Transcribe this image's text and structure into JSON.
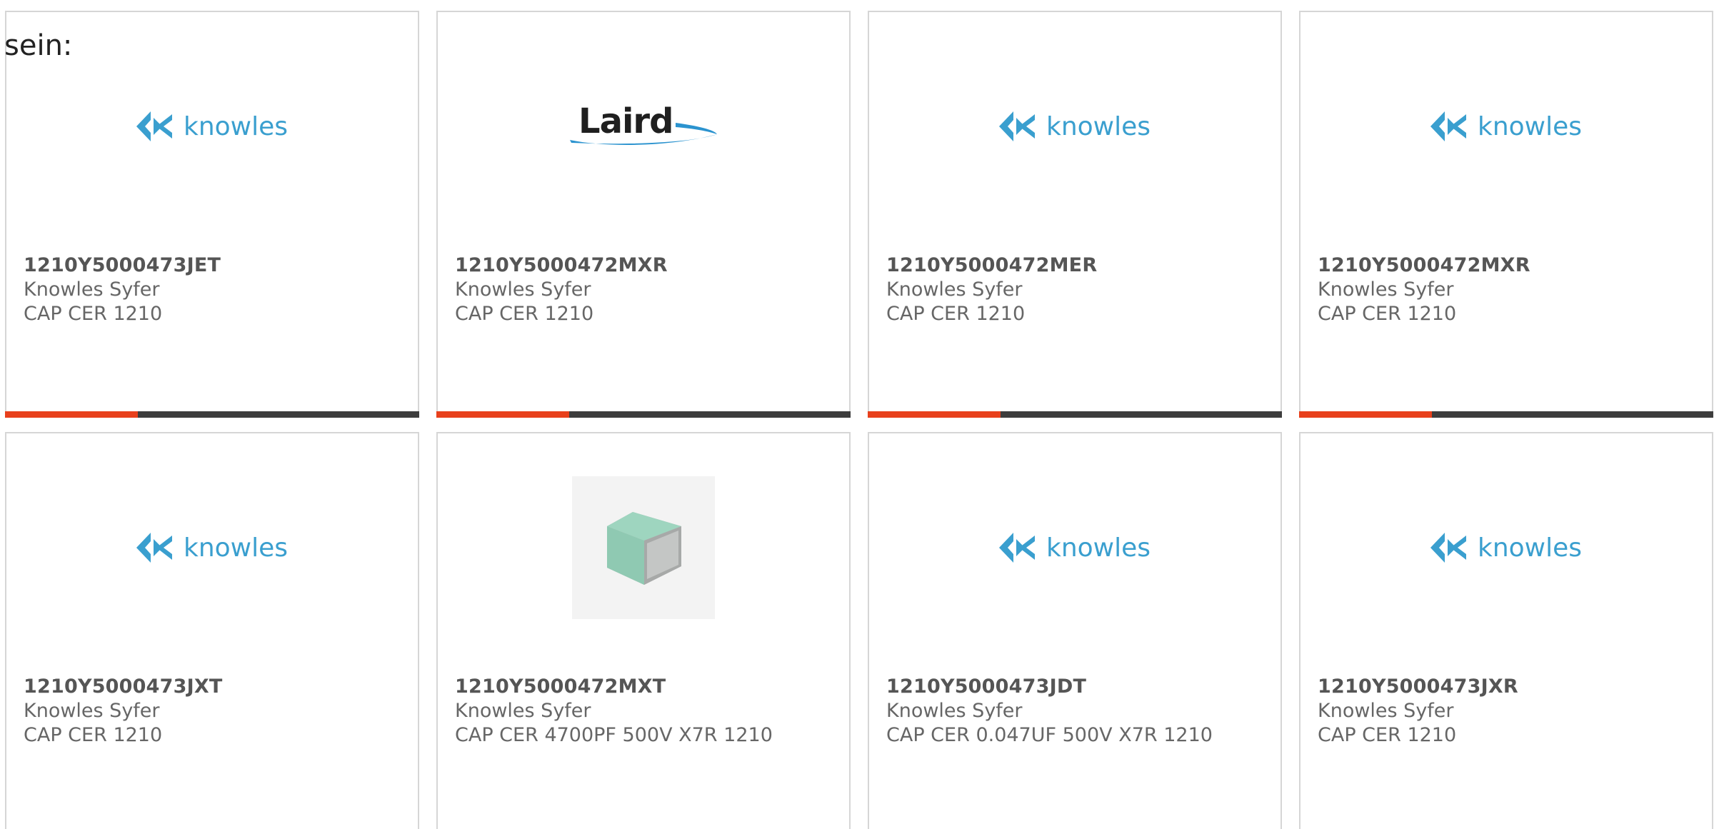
{
  "lead_text": "sein:",
  "colors": {
    "accent": "#e8401c",
    "bar_track": "#3d3d3d",
    "knowles_blue": "#3a9fcf",
    "card_border": "#d6d6d6"
  },
  "cards": [
    {
      "part_number": "1210Y5000473JET",
      "manufacturer": "Knowles Syfer",
      "description": "CAP CER 1210",
      "logo": "knowles-logo",
      "logo_text": "knowles",
      "progress": 0.32
    },
    {
      "part_number": "1210Y5000472MXR",
      "manufacturer": "Knowles Syfer",
      "description": "CAP CER 1210",
      "logo": "laird-logo",
      "logo_text": "Laird",
      "progress": 0.32
    },
    {
      "part_number": "1210Y5000472MER",
      "manufacturer": "Knowles Syfer",
      "description": "CAP CER 1210",
      "logo": "knowles-logo",
      "logo_text": "knowles",
      "progress": 0.32
    },
    {
      "part_number": "1210Y5000472MXR",
      "manufacturer": "Knowles Syfer",
      "description": "CAP CER 1210",
      "logo": "knowles-logo",
      "logo_text": "knowles",
      "progress": 0.32
    },
    {
      "part_number": "1210Y5000473JXT",
      "manufacturer": "Knowles Syfer",
      "description": "CAP CER 1210",
      "logo": "knowles-logo",
      "logo_text": "knowles"
    },
    {
      "part_number": "1210Y5000472MXT",
      "manufacturer": "Knowles Syfer",
      "description": "CAP CER 4700PF 500V X7R 1210",
      "logo": "capacitor-chip-image"
    },
    {
      "part_number": "1210Y5000473JDT",
      "manufacturer": "Knowles Syfer",
      "description": "CAP CER 0.047UF 500V X7R 1210",
      "logo": "knowles-logo",
      "logo_text": "knowles"
    },
    {
      "part_number": "1210Y5000473JXR",
      "manufacturer": "Knowles Syfer",
      "description": "CAP CER 1210",
      "logo": "knowles-logo",
      "logo_text": "knowles"
    }
  ]
}
